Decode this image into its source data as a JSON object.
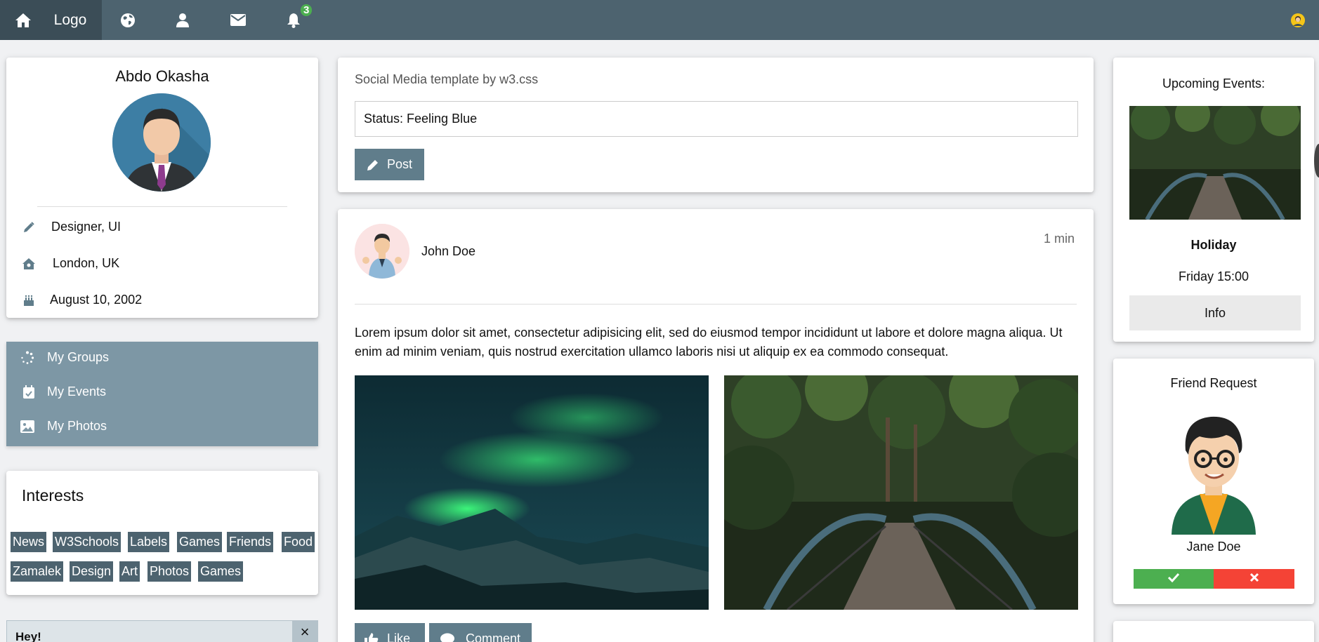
{
  "nav": {
    "logo": "Logo",
    "notification_count": "3"
  },
  "profile": {
    "name": "Abdo Okasha",
    "job": "Designer, UI",
    "location": "London, UK",
    "birthday": "August 10, 2002"
  },
  "groups": {
    "items": [
      {
        "label": "My Groups",
        "icon": "spinner-icon"
      },
      {
        "label": "My Events",
        "icon": "calendar-check-icon"
      },
      {
        "label": "My Photos",
        "icon": "image-icon"
      }
    ]
  },
  "interests": {
    "title": "Interests",
    "tags": [
      "News",
      "W3Schools",
      "Labels",
      "Games",
      "Friends",
      "Food",
      "Zamalek",
      "Design",
      "Art",
      "Photos",
      "Games"
    ]
  },
  "alert": {
    "title": "Hey!",
    "close": "×"
  },
  "status_card": {
    "title": "Social Media template by w3.css",
    "status_value": "Status: Feeling Blue",
    "post_label": "Post"
  },
  "post": {
    "author": "John Doe",
    "time": "1 min",
    "text": "Lorem ipsum dolor sit amet, consectetur adipisicing elit, sed do eiusmod tempor incididunt ut labore et dolore magna aliqua. Ut enim ad minim veniam, quis nostrud exercitation ullamco laboris nisi ut aliquip ex ea commodo consequat.",
    "like_label": "Like",
    "comment_label": "Comment"
  },
  "events": {
    "title": "Upcoming Events:",
    "event_name": "Holiday",
    "event_time": "Friday 15:00",
    "info_label": "Info"
  },
  "friend_request": {
    "title": "Friend Request",
    "name": "Jane Doe"
  },
  "colors": {
    "topbar": "#4d636f",
    "slate": "#607d8b",
    "accept": "#4caf50",
    "decline": "#f44336"
  }
}
